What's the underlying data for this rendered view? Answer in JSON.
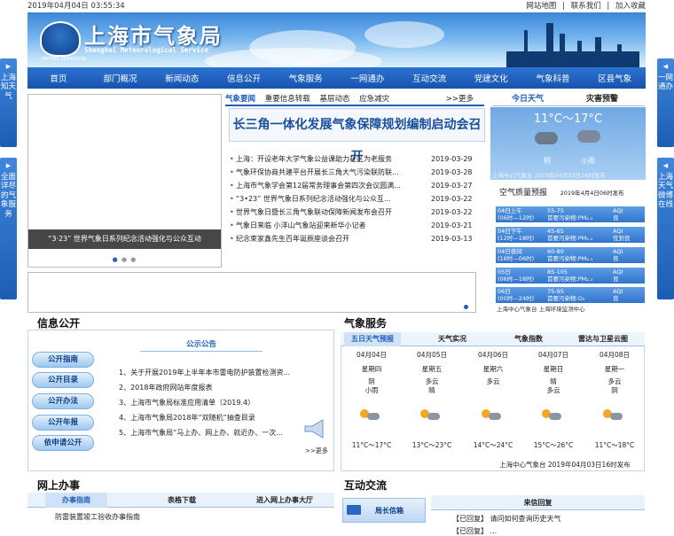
{
  "topbar": {
    "datetime": "2019年04月04日  03:55:34",
    "links": [
      "网站地图",
      "|",
      "联系我们",
      "|",
      "加入收藏"
    ]
  },
  "header": {
    "title": "上海市气象局",
    "subtitle": "Shanghai Meteorological Service",
    "emblem_caption": "METEO SHANGHAI"
  },
  "nav": [
    "首页",
    "部门概况",
    "新闻动态",
    "信息公开",
    "气象服务",
    "一网通办",
    "互动交流",
    "党建文化",
    "气象科普",
    "区县气象"
  ],
  "side_left": [
    {
      "label": "上海知天气"
    },
    {
      "label": "全面详尽的气象服务"
    }
  ],
  "side_right": [
    {
      "label": "一网通办"
    },
    {
      "label": "上海天气微博在线"
    }
  ],
  "slideshow": {
    "caption": "“3·23” 世界气象日系列纪念活动强化与公众互动"
  },
  "news": {
    "tabs": [
      "气象要闻",
      "重要信息转载",
      "基层动态",
      "应急减灾"
    ],
    "more": ">>更多",
    "headline": "长三角一体化发展气象保障规划编制启动会召开",
    "items": [
      {
        "title": "上海：开设老年大学气象公益课助力社区为老服务",
        "date": "2019-03-29"
      },
      {
        "title": "气象环保协商共建平台开展长三角大气污染联防联...",
        "date": "2019-03-28"
      },
      {
        "title": "上海市气象学会第12届常务理事会第四次会议圆满...",
        "date": "2019-03-27"
      },
      {
        "title": "“3•23” 世界气象日系列纪念活动强化与公众互...",
        "date": "2019-03-22"
      },
      {
        "title": "世界气象日暨长三角气象联动保障新闻发布会召开",
        "date": "2019-03-22"
      },
      {
        "title": "气象日来临 小洋山气象站迎来新华小记者",
        "date": "2019-03-21"
      },
      {
        "title": "纪念束家鑫先生百年诞辰座谈会召开",
        "date": "2019-03-13"
      }
    ]
  },
  "weather": {
    "tabs": [
      "今日天气",
      "灾害预警"
    ],
    "temp": "11°C～17°C",
    "conds": [
      "阴",
      "小雨"
    ],
    "footer": "上海中心气象台  2019年04月03日16时发布"
  },
  "aq": {
    "title": "空气质量预报",
    "issued": "2019年4月4日06时发布",
    "rows": [
      {
        "period": "04日上午",
        "time": "(06时—12时)",
        "range": "55-75",
        "pollutant": "首要污染物:PM₂.₅",
        "label": "AQI",
        "level": "良"
      },
      {
        "period": "04日下午",
        "time": "(12时—18时)",
        "range": "45-65",
        "pollutant": "首要污染物:PM₂.₅",
        "label": "AQI",
        "level": "优到良"
      },
      {
        "period": "04日夜间",
        "time": "(18时—06时)",
        "range": "60-80",
        "pollutant": "首要污染物:PM₂.₅",
        "label": "AQI",
        "level": "良"
      },
      {
        "period": "05日",
        "time": "(06时—18时)",
        "range": "85-105",
        "pollutant": "首要污染物:PM₂.₅",
        "label": "AQI",
        "level": "良"
      },
      {
        "period": "06日",
        "time": "(00时—24时)",
        "range": "75-95",
        "pollutant": "首要污染物:O₃",
        "label": "AQI",
        "level": "良"
      }
    ],
    "footer": "上海中心气象台 上海环境监测中心"
  },
  "info": {
    "title": "信息公开",
    "buttons": [
      "公开指南",
      "公开目录",
      "公开办法",
      "公开年报",
      "依申请公开"
    ],
    "notice_title": "公示公告",
    "notices": [
      "1、关于开展2019年上半年本市雷电防护装置检测资...",
      "2、2018年政府网站年度报表",
      "3、上海市气象局标准应用清单（2019.4）",
      "4、上海市气象局2018年“双随机”抽查目录",
      "5、上海市气象局“马上办、网上办、就近办、一次..."
    ],
    "more": ">>更多"
  },
  "forecast": {
    "title": "气象服务",
    "tabs": [
      "五日天气预报",
      "天气实况",
      "气象指数",
      "雷达与卫星云图"
    ],
    "days": [
      {
        "date": "04月04日",
        "weekday": "星期四",
        "cond": "阴\n小雨",
        "temp": "11°C～17°C"
      },
      {
        "date": "04月05日",
        "weekday": "星期五",
        "cond": "多云\n晴",
        "temp": "13°C～23°C"
      },
      {
        "date": "04月06日",
        "weekday": "星期六",
        "cond": "多云",
        "temp": "14°C～24°C"
      },
      {
        "date": "04月07日",
        "weekday": "星期日",
        "cond": "晴\n多云",
        "temp": "15°C～26°C"
      },
      {
        "date": "04月08日",
        "weekday": "星期一",
        "cond": "多云\n阴",
        "temp": "11°C～18°C"
      }
    ],
    "footer": "上海中心气象台 2019年04月03日16时发布"
  },
  "online": {
    "title": "网上办事",
    "tabs": [
      "办事指南",
      "表格下载",
      "进入网上办事大厅"
    ],
    "items": [
      "防雷装置竣工验收办事指南"
    ]
  },
  "interact": {
    "title": "互动交流",
    "mailbox": "局长信箱",
    "letters_title": "来信回复",
    "letters": [
      "【已回复】 请问如何查询历史天气",
      "【已回复】 ..."
    ]
  }
}
